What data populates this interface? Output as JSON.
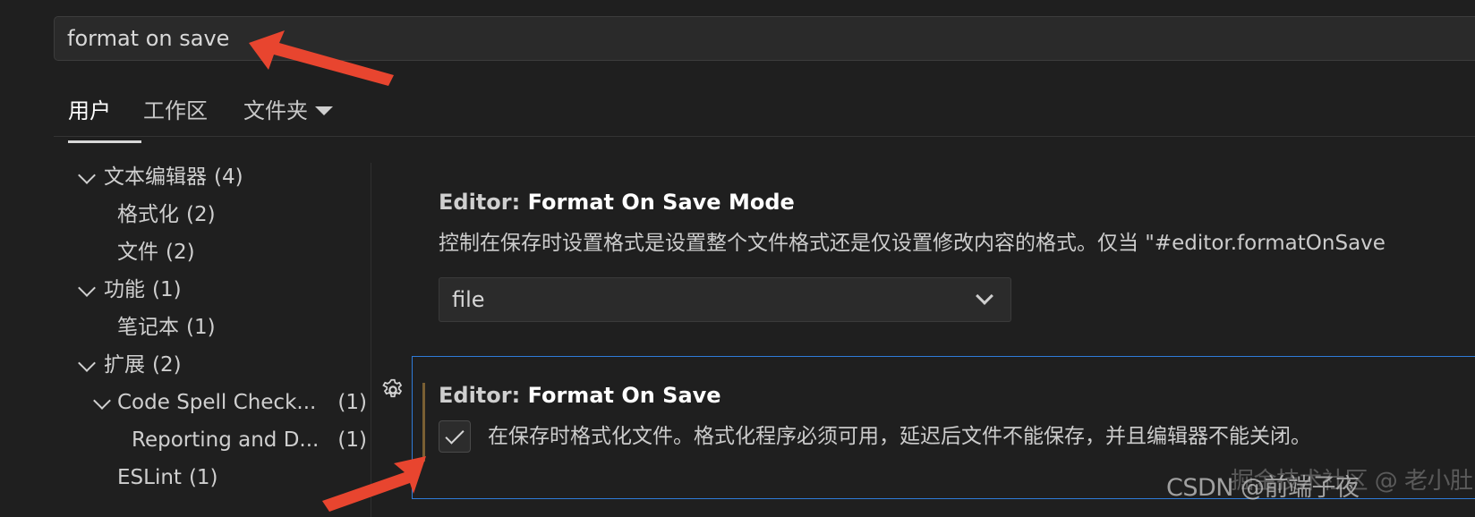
{
  "search": {
    "value": "format on save"
  },
  "tabs": [
    {
      "label": "用户"
    },
    {
      "label": "工作区"
    },
    {
      "label": "文件夹"
    }
  ],
  "toc": [
    {
      "label": "文本编辑器",
      "count": "(4)"
    },
    {
      "label": "格式化",
      "count": "(2)"
    },
    {
      "label": "文件",
      "count": "(2)"
    },
    {
      "label": "功能",
      "count": "(1)"
    },
    {
      "label": "笔记本",
      "count": "(1)"
    },
    {
      "label": "扩展",
      "count": "(2)"
    },
    {
      "label": "Code Spell Check...",
      "count": "(1)"
    },
    {
      "label": "Reporting and D...",
      "count": "(1)"
    },
    {
      "label": "ESLint",
      "count": "(1)"
    }
  ],
  "settings": {
    "format_on_save_mode": {
      "category": "Editor: ",
      "name": "Format On Save Mode",
      "description": "控制在保存时设置格式是设置整个文件格式还是仅设置修改内容的格式。仅当 \"#editor.formatOnSave",
      "selected": "file"
    },
    "format_on_save": {
      "category": "Editor: ",
      "name": "Format On Save",
      "description": "在保存时格式化文件。格式化程序必须可用，延迟后文件不能保存，并且编辑器不能关闭。",
      "checked": true
    }
  },
  "watermark": {
    "text": "CSDN @前端子夜",
    "overlay": "掘金技术社区 @ 老小肚"
  },
  "colors": {
    "focus_border": "#2f7bd8",
    "annotation_arrow": "#e8452f",
    "modified_indicator": "#7a5f33"
  }
}
